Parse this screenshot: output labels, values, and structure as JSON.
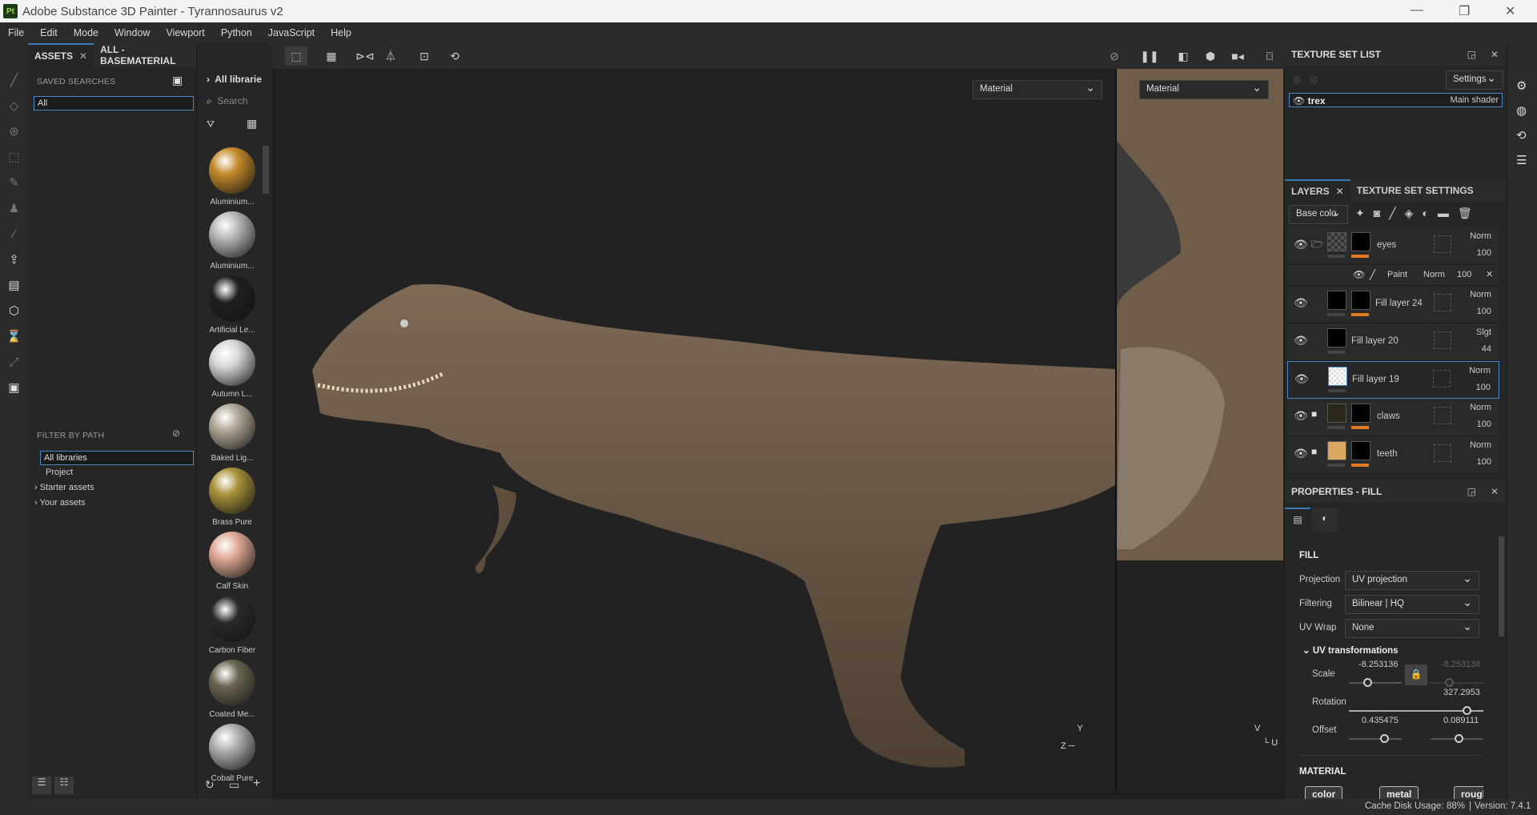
{
  "app": {
    "logo": "Pt",
    "title": "Adobe Substance 3D Painter - Tyrannosaurus v2"
  },
  "menu": [
    "File",
    "Edit",
    "Mode",
    "Window",
    "Viewport",
    "Python",
    "JavaScript",
    "Help"
  ],
  "assets": {
    "tab_label": "ASSETS",
    "tab2_label": "ALL - BASEMATERIAL",
    "saved_searches": "SAVED SEARCHES",
    "search_value": "All",
    "filter_by_path": "FILTER BY PATH",
    "paths": [
      "All libraries",
      "Project",
      "Starter assets",
      "Your assets"
    ],
    "breadcrumb": "All librarie",
    "search_placeholder": "Search",
    "items": [
      {
        "label": "Aluminium...",
        "color": "#c48a2a"
      },
      {
        "label": "Aluminium...",
        "color": "#b8b8b8"
      },
      {
        "label": "Artificial Le...",
        "color": "#202020"
      },
      {
        "label": "Autumn L...",
        "color": "#d8d8d8"
      },
      {
        "label": "Baked Lig...",
        "color": "#b3a898"
      },
      {
        "label": "Brass Pure",
        "color": "#a8923a"
      },
      {
        "label": "Calf Skin",
        "color": "#e0aa96"
      },
      {
        "label": "Carbon Fiber",
        "color": "#2a2a2a"
      },
      {
        "label": "Coated Me...",
        "color": "#6b6550"
      },
      {
        "label": "Cobalt Pure",
        "color": "#b0b0b0"
      }
    ]
  },
  "viewport": {
    "mode_3d": "Material",
    "mode_2d": "Material",
    "axis_3d": {
      "z": "Z",
      "y": "Y"
    },
    "axis_2d": {
      "v": "V",
      "u": "U"
    }
  },
  "texture_set_list": {
    "title": "TEXTURE SET LIST",
    "settings": "Settings",
    "set_name": "trex",
    "shader": "Main shader"
  },
  "layers": {
    "tab": "LAYERS",
    "tab2": "TEXTURE SET SETTINGS",
    "channel": "Base colo",
    "items": [
      {
        "name": "eyes",
        "blend": "Norm",
        "opacity": "100"
      },
      {
        "name": "Paint",
        "blend": "Norm",
        "opacity": "100"
      },
      {
        "name": "Fill layer 24",
        "blend": "Norm",
        "opacity": "100"
      },
      {
        "name": "Fill layer 20",
        "blend": "Slgt",
        "opacity": "44"
      },
      {
        "name": "Fill layer 19",
        "blend": "Norm",
        "opacity": "100"
      },
      {
        "name": "claws",
        "blend": "Norm",
        "opacity": "100"
      },
      {
        "name": "teeth",
        "blend": "Norm",
        "opacity": "100"
      }
    ]
  },
  "properties": {
    "title": "PROPERTIES - FILL",
    "fill": "FILL",
    "projection_label": "Projection",
    "projection": "UV projection",
    "filtering_label": "Filtering",
    "filtering": "Bilinear | HQ",
    "uvwrap_label": "UV Wrap",
    "uvwrap": "None",
    "uvt": "UV transformations",
    "scale_label": "Scale",
    "scale_u": "-8.253136",
    "scale_v": "-8.253136",
    "rotation_label": "Rotation",
    "rotation": "327.2953",
    "offset_label": "Offset",
    "offset_u": "0.435475",
    "offset_v": "0.089111",
    "material": "MATERIAL",
    "chips": [
      "color",
      "metal",
      "rough"
    ]
  },
  "status": {
    "cache_label": "Cache Disk Usage:",
    "cache_value": "88%",
    "version": "Version: 7.4.1"
  }
}
